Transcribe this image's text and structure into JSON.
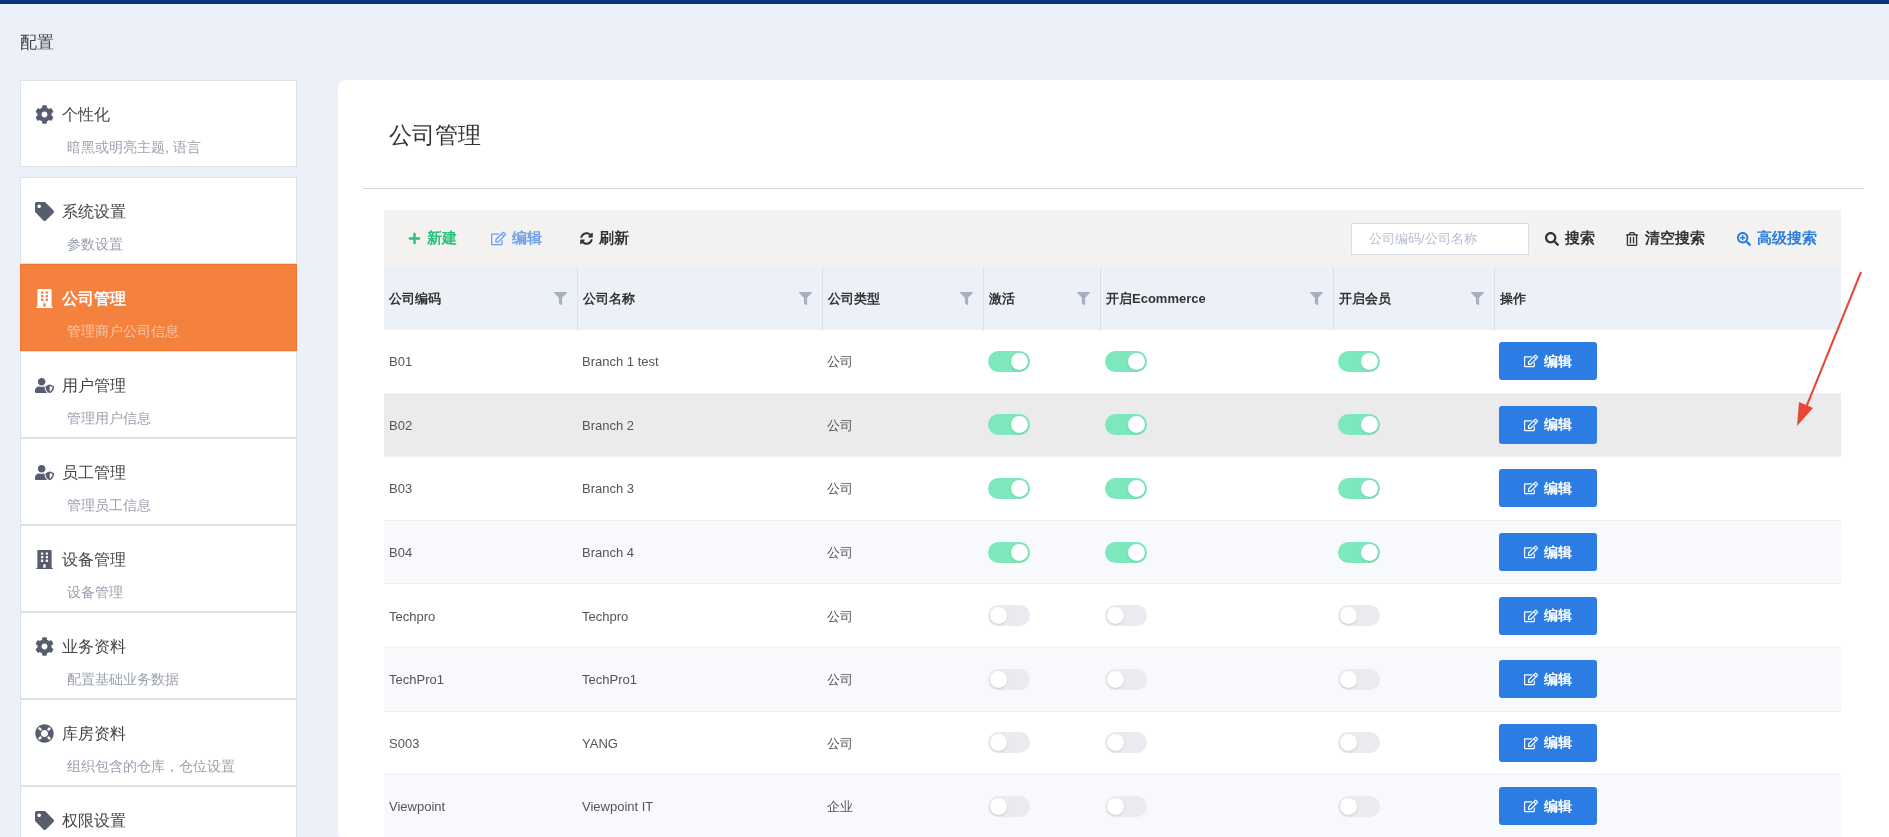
{
  "page_title": "配置",
  "sidebar": {
    "items": [
      {
        "title": "个性化",
        "subtitle": "暗黑或明亮主题, 语言",
        "selected": false
      },
      {
        "title": "系统设置",
        "subtitle": "参数设置",
        "selected": false
      },
      {
        "title": "公司管理",
        "subtitle": "管理商户公司信息",
        "selected": true
      },
      {
        "title": "用户管理",
        "subtitle": "管理用户信息",
        "selected": false
      },
      {
        "title": "员工管理",
        "subtitle": "管理员工信息",
        "selected": false
      },
      {
        "title": "设备管理",
        "subtitle": "设备管理",
        "selected": false
      },
      {
        "title": "业务资料",
        "subtitle": "配置基础业务数据",
        "selected": false
      },
      {
        "title": "库房资料",
        "subtitle": "组织包含的仓库，仓位设置",
        "selected": false
      },
      {
        "title": "权限设置",
        "selected": false
      }
    ]
  },
  "panel": {
    "title": "公司管理",
    "toolbar": {
      "new": "新建",
      "edit": "编辑",
      "refresh": "刷新",
      "search_placeholder": "公司编码/公司名称",
      "search": "搜索",
      "clear": "清空搜索",
      "advanced": "高级搜索"
    },
    "table": {
      "columns": [
        {
          "label": "公司编码"
        },
        {
          "label": "公司名称"
        },
        {
          "label": "公司类型"
        },
        {
          "label": "激活"
        },
        {
          "label": "开启Ecommerce"
        },
        {
          "label": "开启会员"
        },
        {
          "label": "操作"
        }
      ],
      "rows": [
        {
          "code": "B01",
          "name": "Branch 1 test",
          "type": "公司",
          "active": true,
          "ecommerce": true,
          "member": true,
          "action": "编辑",
          "selected": false
        },
        {
          "code": "B02",
          "name": "Branch 2",
          "type": "公司",
          "active": true,
          "ecommerce": true,
          "member": true,
          "action": "编辑",
          "selected": true
        },
        {
          "code": "B03",
          "name": "Branch 3",
          "type": "公司",
          "active": true,
          "ecommerce": true,
          "member": true,
          "action": "编辑",
          "selected": false
        },
        {
          "code": "B04",
          "name": "Branch 4",
          "type": "公司",
          "active": true,
          "ecommerce": true,
          "member": true,
          "action": "编辑",
          "selected": false
        },
        {
          "code": "Techpro",
          "name": "Techpro",
          "type": "公司",
          "active": false,
          "ecommerce": false,
          "member": false,
          "action": "编辑",
          "selected": false
        },
        {
          "code": "TechPro1",
          "name": "TechPro1",
          "type": "公司",
          "active": false,
          "ecommerce": false,
          "member": false,
          "action": "编辑",
          "selected": false
        },
        {
          "code": "S003",
          "name": "YANG",
          "type": "公司",
          "active": false,
          "ecommerce": false,
          "member": false,
          "action": "编辑",
          "selected": false
        },
        {
          "code": "Viewpoint",
          "name": "Viewpoint IT",
          "type": "企业",
          "active": false,
          "ecommerce": false,
          "member": false,
          "action": "编辑",
          "selected": false
        }
      ]
    }
  }
}
